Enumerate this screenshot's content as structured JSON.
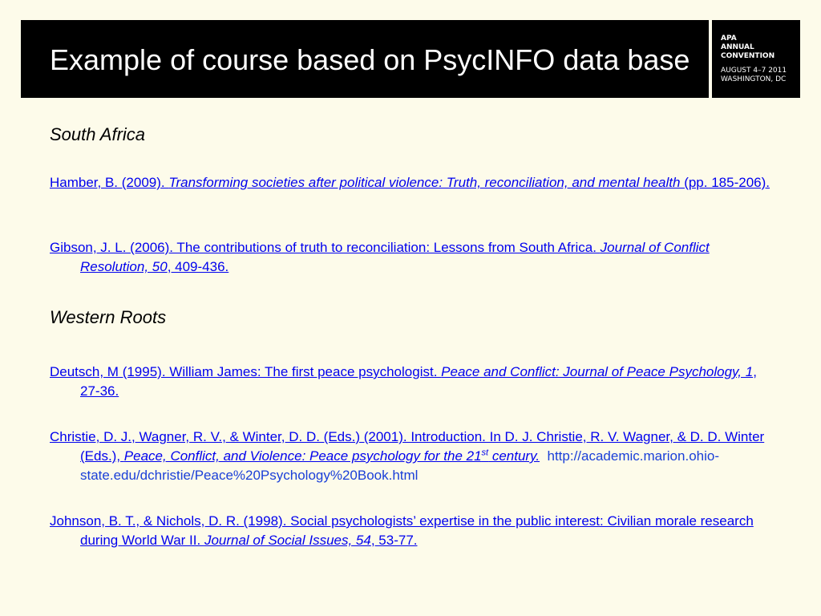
{
  "slide": {
    "title": "Example of course based on PsycINFO data base"
  },
  "logo": {
    "line1": "APA",
    "line2": "ANNUAL",
    "line3": "CONVENTION",
    "line4": "AUGUST 4–7 2011",
    "line5": "WASHINGTON, DC"
  },
  "sections": [
    {
      "heading": "South Africa"
    },
    {
      "heading": "Western Roots"
    }
  ],
  "refs": {
    "hamber": {
      "part1": "Hamber, B. (2009). ",
      "italic": "Transforming societies after political violence: Truth, reconciliation, and mental health",
      "part2": " (pp. 185-206)."
    },
    "gibson": {
      "part1": "Gibson, J. L. (2006). The contributions of truth to reconciliation: Lessons from South Africa.  ",
      "italic": "Journal of Conflict Resolution, 50",
      "part2": ", 409-436."
    },
    "deutsch": {
      "part1": "Deutsch, M (1995).  William James: The first peace psychologist.  ",
      "italic": "Peace and Conflict: Journal of Peace Psychology, 1",
      "part2": ", 27-36."
    },
    "christie": {
      "part1": "Christie, D. J., Wagner, R. V., & Winter, D. D. (Eds.) (2001).  Introduction.  In D. J. Christie, R. V. Wagner, & D. D. Winter (Eds.), ",
      "italic": "Peace, Conflict, and Violence: Peace psychology for the 21",
      "sup": "st",
      "italic2": " century.",
      "url": "http://academic.marion.ohio-state.edu/dchristie/Peace%20Psychology%20Book.html"
    },
    "johnson": {
      "part1": "Johnson, B. T., & Nichols, D. R. (1998). Social psychologists’ expertise in the public interest: Civilian morale research during World War II.  ",
      "italic": "Journal of Social Issues, 54",
      "part2": ", 53-77."
    }
  }
}
